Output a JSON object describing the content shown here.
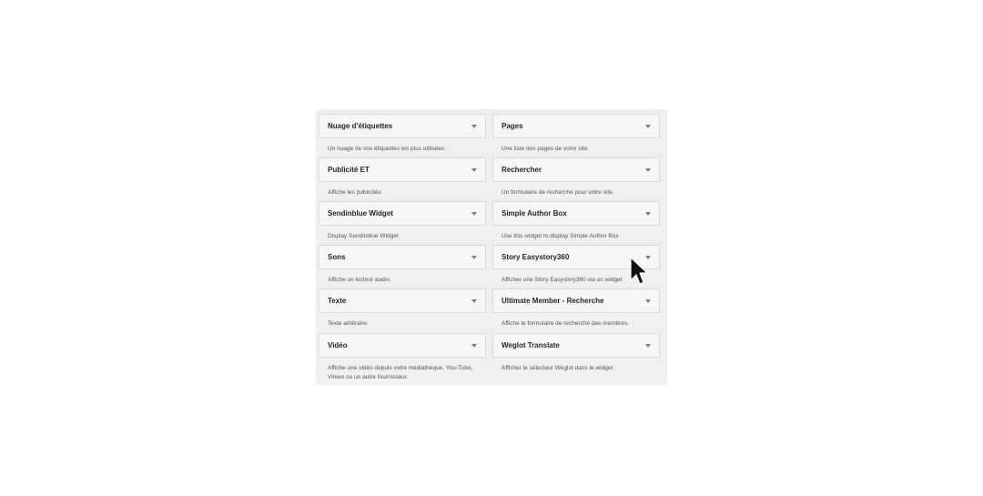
{
  "widgets": [
    {
      "title": "Nuage d'étiquettes",
      "desc": "Un nuage de vos étiquettes les plus utilisées."
    },
    {
      "title": "Pages",
      "desc": "Une liste des pages de votre site."
    },
    {
      "title": "Publicité ET",
      "desc": "Affiche les publicités"
    },
    {
      "title": "Rechercher",
      "desc": "Un formulaire de recherche pour votre site."
    },
    {
      "title": "Sendinblue Widget",
      "desc": "Display Sendinblue Widget"
    },
    {
      "title": "Simple Author Box",
      "desc": "Use this widget to display Simple Author Box"
    },
    {
      "title": "Sons",
      "desc": "Affiche un lecteur audio."
    },
    {
      "title": "Story Easystory360",
      "desc": "Afficher une Story Easystory360 via un widget"
    },
    {
      "title": "Texte",
      "desc": "Texte arbitraire."
    },
    {
      "title": "Ultimate Member - Recherche",
      "desc": "Affiche le formulaire de recherche des membres."
    },
    {
      "title": "Vidéo",
      "desc": "Affiche une vidéo depuis votre médiathèque, You-Tube, Vimeo ou un autre fournisseur."
    },
    {
      "title": "Weglot Translate",
      "desc": "Afficher le sélecteur Weglot dans le widget"
    }
  ],
  "icons": {
    "toggle": "triangle-down-icon",
    "cursor": "mouse-pointer-icon"
  },
  "colors": {
    "panel_bg": "#f0f0f1",
    "widget_bg": "#f6f7f7",
    "border": "#dcdcde",
    "title": "#1d2327",
    "desc": "#50575e"
  }
}
